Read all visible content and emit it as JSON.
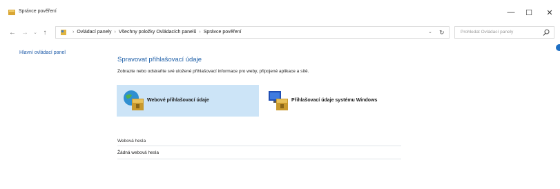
{
  "window": {
    "title": "Správce pověření",
    "minimize_glyph": "—",
    "maximize_glyph": "☐",
    "close_glyph": "✕",
    "app_icon": "credential-manager-icon"
  },
  "nav": {
    "back_glyph": "←",
    "forward_glyph": "→",
    "recent_glyph": "⌄",
    "up_glyph": "↑",
    "breadcrumbs": [
      "Ovládací panely",
      "Všechny položky Ovládacích panelů",
      "Správce pověření"
    ],
    "dropdown_glyph": "⌄",
    "refresh_glyph": "↻",
    "search_placeholder": "Prohledat Ovládací panely"
  },
  "sidebar": {
    "home_link": "Hlavní ovládací panel"
  },
  "main": {
    "heading": "Spravovat přihlašovací údaje",
    "description": "Zobrazte nebo odstraňte své uložené přihlašovací informace pro weby, připojené aplikace a sítě.",
    "tiles": [
      {
        "label": "Webové přihlašovací údaje",
        "selected": true,
        "icon": "web-credentials-icon"
      },
      {
        "label": "Přihlašovací údaje systému Windows",
        "selected": false,
        "icon": "windows-credentials-icon"
      }
    ],
    "vault_header": "Webová hesla",
    "vault_empty": "Žádná webová hesla"
  },
  "colors": {
    "accent": "#1e5fa8",
    "selected_tile": "#cce4f7"
  }
}
